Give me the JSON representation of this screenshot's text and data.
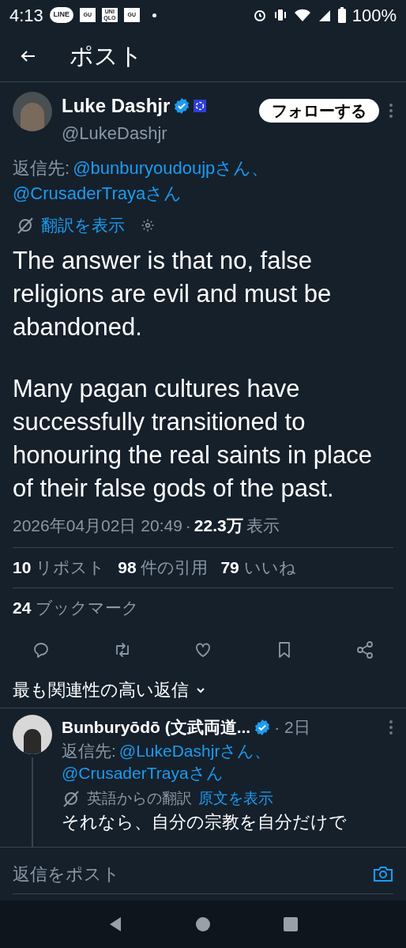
{
  "status_bar": {
    "time": "4:13",
    "notification_icons": [
      "LINE",
      "GU",
      "UNI QLO",
      "GU"
    ],
    "battery": "100%"
  },
  "header": {
    "title": "ポスト"
  },
  "post": {
    "author": {
      "name": "Luke Dashjr",
      "handle": "@LukeDashjr",
      "verified": true
    },
    "follow_button": "フォローする",
    "reply_to": {
      "prefix": "返信先:",
      "mentions": [
        "@bunburyoudoujpさん、",
        "@CrusaderTrayaさん"
      ]
    },
    "translate": "翻訳を表示",
    "body": [
      "The answer is that no, false religions are evil and must be abandoned.",
      "Many pagan cultures have successfully transitioned to honouring the real saints in place of their false gods of the past."
    ],
    "timestamp": "2026年04月02日 20:49",
    "separator": "·",
    "views_count": "22.3万",
    "views_label": "表示",
    "stats": [
      {
        "count": "10",
        "label": "リポスト"
      },
      {
        "count": "98",
        "label": "件の引用"
      },
      {
        "count": "79",
        "label": "いいね"
      }
    ],
    "bookmarks": {
      "count": "24",
      "label": "ブックマーク"
    },
    "actions": [
      {
        "kind": "reply"
      },
      {
        "kind": "repost"
      },
      {
        "kind": "like"
      },
      {
        "kind": "bookmark"
      },
      {
        "kind": "share"
      }
    ]
  },
  "replies_sort": "最も関連性の高い返信",
  "reply": {
    "name": "Bunburyōdō (文武両道...",
    "verified": true,
    "age": "· 2日",
    "reply_to": {
      "prefix": "返信先:",
      "mentions": [
        "@LukeDashjrさん、",
        "@CrusaderTrayaさん"
      ]
    },
    "translated_from": "英語からの翻訳",
    "show_original": "原文を表示",
    "text": "それなら、自分の宗教を自分だけで"
  },
  "composer": {
    "placeholder": "返信をポスト"
  }
}
